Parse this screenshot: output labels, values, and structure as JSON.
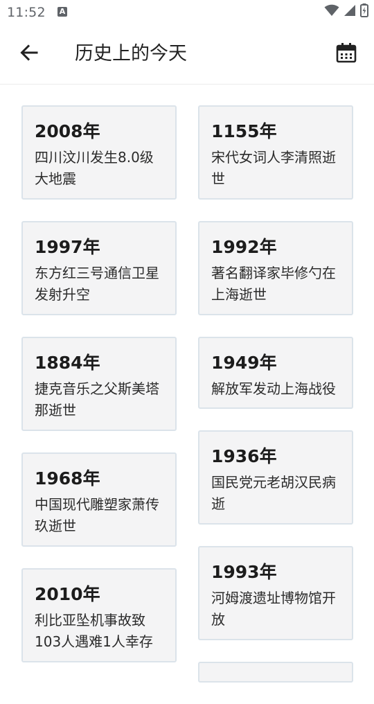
{
  "status_bar": {
    "time": "11:52",
    "notification_badge": "A",
    "icons": [
      "wifi-icon",
      "signal-icon",
      "battery-icon"
    ]
  },
  "app_bar": {
    "title": "历史上的今天",
    "back_icon": "arrow-left-icon",
    "calendar_icon": "calendar-icon"
  },
  "events_left": [
    {
      "year": "2008年",
      "event": "四川汶川发生8.0级大地震"
    },
    {
      "year": "1997年",
      "event": "东方红三号通信卫星发射升空"
    },
    {
      "year": "1884年",
      "event": "捷克音乐之父斯美塔那逝世"
    },
    {
      "year": "1968年",
      "event": "中国现代雕塑家萧传玖逝世"
    },
    {
      "year": "2010年",
      "event": "利比亚坠机事故致103人遇难1人幸存"
    }
  ],
  "events_right": [
    {
      "year": "1155年",
      "event": "宋代女词人李清照逝世"
    },
    {
      "year": "1992年",
      "event": "著名翻译家毕修勺在上海逝世"
    },
    {
      "year": "1949年",
      "event": "解放军发动上海战役"
    },
    {
      "year": "1936年",
      "event": "国民党元老胡汉民病逝"
    },
    {
      "year": "1993年",
      "event": "河姆渡遗址博物馆开放"
    }
  ],
  "colors": {
    "card_bg": "#f4f4f5",
    "card_border": "#dbe3ea",
    "text_primary": "#1c1c1c",
    "status_icon": "#5f6368"
  }
}
